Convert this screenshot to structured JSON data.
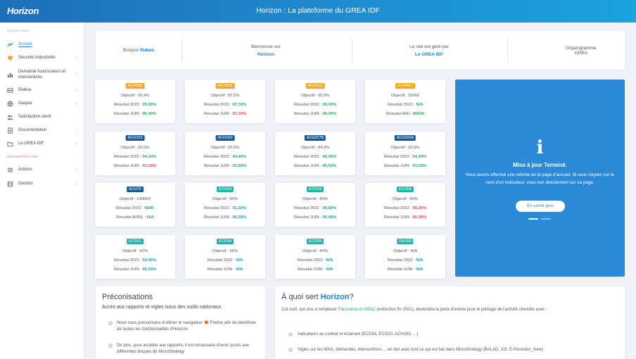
{
  "header": {
    "logo": "Horizon",
    "title": "Horizon : La plateforme du GREA IDF"
  },
  "sidebar": {
    "nav_heading": "NAVIGATION",
    "admin_heading": "ADMINISTRATION",
    "items": [
      {
        "label": "Accueil",
        "icon": "dashboard-icon"
      },
      {
        "label": "Sécurité Industrielle",
        "icon": "shield-icon"
      },
      {
        "label": "Demande fournisseurs et interventions",
        "icon": "chart-bars-icon"
      },
      {
        "label": "Relève",
        "icon": "inbox-icon"
      },
      {
        "label": "Gazpar",
        "icon": "globe-icon"
      },
      {
        "label": "Satisfaction client",
        "icon": "users-icon"
      },
      {
        "label": "Documentation",
        "icon": "document-icon"
      },
      {
        "label": "Le GREA IDF",
        "icon": "folder-icon"
      }
    ],
    "admin_items": [
      {
        "label": "Actions",
        "icon": "menu-icon"
      },
      {
        "label": "Gestion",
        "icon": "database-icon"
      }
    ]
  },
  "welcome": {
    "greeting": "Bonjour",
    "user": "Ruben",
    "welcome_line": "Bienvenue sur",
    "welcome_app": "Horizon",
    "managed_line": "Le site est géré par",
    "managed_by": "Le GREA IDF",
    "org_line1": "Organigramme",
    "org_line2": "GREA"
  },
  "cards": [
    {
      "code": "ACH068",
      "badge": "orange",
      "objective": "Objectif : 95,4%",
      "l2_label": "Résultat 2022 : ",
      "l2_value": "95,90%",
      "l2_color": "green",
      "l3_label": "Résultat JUIN : ",
      "l3_value": "96,00%",
      "l3_color": "green"
    },
    {
      "code": "ACH068",
      "badge": "orange",
      "objective": "Objectif : 87,5%",
      "l2_label": "Résultat 2022 : ",
      "l2_value": "87,70%",
      "l2_color": "green",
      "l3_label": "Résultat JUIN : ",
      "l3_value": "87,20%",
      "l3_color": "red"
    },
    {
      "code": "ACH025",
      "badge": "orange",
      "objective": "Objectif : 95,9%",
      "l2_label": "Résultat 2022 : ",
      "l2_value": "99,00%",
      "l2_color": "green",
      "l3_label": "Résultat JUIN : ",
      "l3_value": "99,00%",
      "l3_color": "green"
    },
    {
      "code": "ACH94C",
      "badge": "orange",
      "objective": "Objectif : 55000",
      "l2_label": "Résultat 2022 : ",
      "l2_value": "N/A",
      "l2_color": "green",
      "l3_label": "Résultat MAI : ",
      "l3_value": "80436",
      "l3_color": "green"
    },
    {
      "code": "ACH163",
      "badge": "blue",
      "objective": "Objectif : 93,5%",
      "l2_label": "Résultat 2022 : ",
      "l2_value": "94,10%",
      "l2_color": "green",
      "l3_label": "Résultat JUIN : ",
      "l3_value": "93,50%",
      "l3_color": "red"
    },
    {
      "code": "ACH160",
      "badge": "blue",
      "objective": "Objectif : 93,5%",
      "l2_label": "Résultat 2022 : ",
      "l2_value": "94,40%",
      "l2_color": "green",
      "l3_label": "Résultat JUIN : ",
      "l3_value": "93,60%",
      "l3_color": "green"
    },
    {
      "code": "ACH227B",
      "badge": "blue",
      "objective": "Objectif : 84,3%",
      "l2_label": "Résultat 2022 : ",
      "l2_value": "86,00%",
      "l2_color": "green",
      "l3_label": "Résultat JUIN : ",
      "l3_value": "85,50%",
      "l3_color": "green"
    },
    {
      "code": "ACH160A",
      "badge": "blue",
      "objective": "Objectif : 93,5%",
      "l2_label": "Résultat 2022 : ",
      "l2_value": "94,30%",
      "l2_color": "green",
      "l3_label": "Résultat JUIN : ",
      "l3_value": "93,60%",
      "l3_color": "green"
    },
    {
      "code": "ACH76",
      "badge": "blue",
      "objective": "Objectif : 1300K€",
      "l2_label": "Résultat 2022 : ",
      "l2_value": "680K",
      "l2_color": "green",
      "l3_label": "Résultat AVRIL : ",
      "l3_value": "N/A",
      "l3_color": "green"
    },
    {
      "code": "ECO34",
      "badge": "teal",
      "objective": "Objectif : 90%",
      "l2_label": "Résultat 2022 : ",
      "l2_value": "91,30%",
      "l2_color": "teal-t",
      "l3_label": "Résultat JUIN : ",
      "l3_value": "90,30%",
      "l3_color": "teal-t"
    },
    {
      "code": "ECO34",
      "badge": "teal",
      "objective": "Objectif : 89%",
      "l2_label": "Résultat 2022 : ",
      "l2_value": "90,50%",
      "l2_color": "teal-t",
      "l3_label": "Résultat JUIN : ",
      "l3_value": "90,40%",
      "l3_color": "teal-t"
    },
    {
      "code": "ECO06",
      "badge": "teal",
      "objective": "Objectif : 90%",
      "l2_label": "Résultat 2022 : ",
      "l2_value": "89,20%",
      "l2_color": "red",
      "l3_label": "Résultat JUIN : ",
      "l3_value": "89,30%",
      "l3_color": "red"
    },
    {
      "code": "ECO11",
      "badge": "teal",
      "objective": "Objectif : 92%",
      "l2_label": "Résultat 2022 : ",
      "l2_value": "93,40%",
      "l2_color": "teal-t",
      "l3_label": "Résultat JUIN : ",
      "l3_value": "95,00%",
      "l3_color": "teal-t"
    },
    {
      "code": "ECO34",
      "badge": "teal",
      "objective": "Objectif : 96%",
      "l2_label": "Résultat 2022 : ",
      "l2_value": "N/A",
      "l2_color": "teal-t",
      "l3_label": "Résultat JUIN : ",
      "l3_value": "N/A",
      "l3_color": "teal-t"
    },
    {
      "code": "ECO20",
      "badge": "teal",
      "objective": "Objectif : 80%",
      "l2_label": "Résultat 2022 : ",
      "l2_value": "N/A",
      "l2_color": "teal-t",
      "l3_label": "Résultat JUIN : ",
      "l3_value": "N/A",
      "l3_color": "teal-t"
    },
    {
      "code": "DEV69",
      "badge": "teal",
      "objective": "Objectif : N/A",
      "l2_label": "Résultat 2022 : ",
      "l2_value": "N/A",
      "l2_color": "teal-t",
      "l3_label": "Résultat JUIN : ",
      "l3_value": "N/A",
      "l3_color": "teal-t"
    }
  ],
  "info_panel": {
    "icon": "info-icon",
    "title": "Mise à jour Terminé.",
    "text": "Nous avons effectué une refonte de la page d'accueil. Si vous cliquez sur le nom d'un indicateur, vous irez directement sur sa page.",
    "button": "En savoir plus"
  },
  "preconisations": {
    "title": "Préconisations",
    "subtitle": "Accès aux rapports et vigies issus des outils nationaux",
    "items": [
      "Nous vous préconisons d'utiliser le navigateur 🦊 Firefox afin de bénéficier de toutes les fonctionnalités d'Horizon",
      "De plus, pour accéder aux rapports, il est nécessaire d'avoir accès aux différentes briques de MicroStrategy"
    ]
  },
  "about": {
    "title_prefix": "À quoi sert ",
    "title_app": "Horizon",
    "title_suffix": "?",
    "intro_start": "Cet outil, qui vise à remplacer ",
    "intro_link": "Panorama et AMAC",
    "intro_end": " (extinction fin 2021), deviendra la porte d'entrée pour le pilotage de l'activité clientèle avec :",
    "items": [
      "Indicateurs au contrat et éclairant (ECO34, ECO20, ACH163, ...)",
      "Vigies sur les MAG, demandes, interventions ... en lien avec tout ce qui est fait dans MicroStrategy (BALAD, V2I, E-Pervision_New)"
    ]
  },
  "colors": {
    "accent": "#1f7fcf",
    "header": "#1d6fb8",
    "orange": "#f5a623",
    "navy": "#175a9c",
    "teal": "#1fb5a7",
    "ok": "#26a96c",
    "ko": "#e04b5a"
  }
}
